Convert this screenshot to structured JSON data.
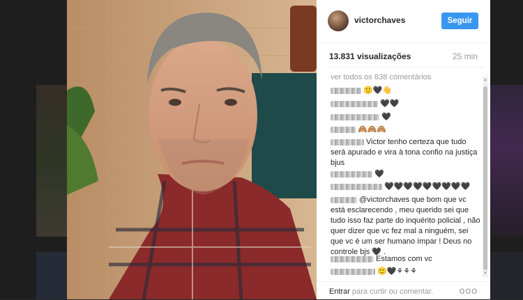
{
  "profile": {
    "username": "victorchaves",
    "follow_label": "Seguir"
  },
  "stats": {
    "views": "13.831 visualizações",
    "time_ago": "25 min"
  },
  "comments": {
    "view_all": "ver todos os 838 comentários",
    "items": [
      {
        "text": "🙂🖤👋"
      },
      {
        "text": "🖤🖤"
      },
      {
        "text": "🖤"
      },
      {
        "text": "🙈🙈🙈"
      },
      {
        "text": "Victor tenho certeza que tudo será apurado e vira à tona confio na justiça bjus"
      },
      {
        "text": "🖤"
      },
      {
        "text": "🖤🖤🖤🖤🖤🖤🖤🖤🖤"
      },
      {
        "text": "@victorchaves que bom que vc está esclarecendo , meu querido sei que tudo isso faz parte do inquérito policial , não quer dizer que vc fez mal a ninguém, sei que vc é um ser humano ímpar ! Deus no controle bjs 🖤 ."
      },
      {
        "text": "Estamos com vc"
      },
      {
        "text": "🙂🖤⚘⚘⚘"
      }
    ]
  },
  "footer": {
    "login_link": "Entrar",
    "login_rest": " para curtir ou comentar.",
    "more": "ooo"
  },
  "colors": {
    "accent": "#3897f0",
    "text": "#262626",
    "muted": "#999999"
  },
  "icons": {
    "more": "more-dots-icon"
  }
}
